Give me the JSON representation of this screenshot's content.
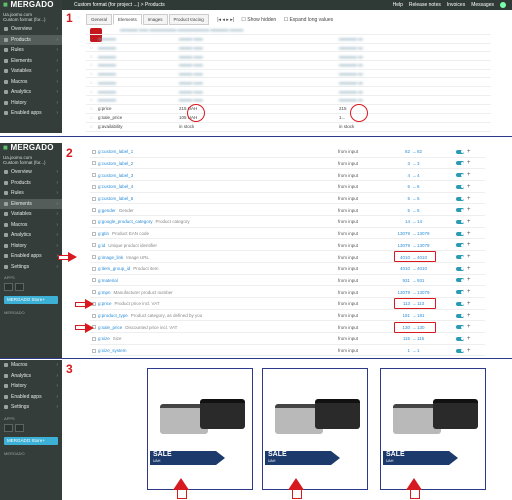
{
  "section_numbers": [
    "1",
    "2",
    "3"
  ],
  "topbar": {
    "breadcrumb": "Custom format (for project ...) > Products",
    "help": "Help",
    "release": "Release notes",
    "invoices": "Invoices",
    "messages": "Messages"
  },
  "sidebar1": {
    "logo": "MERGADO",
    "acct1": "Ua.joomo.com",
    "acct2": "Custom format (for...)",
    "items": [
      "Overview",
      "Products",
      "Rules",
      "Elements",
      "Variables",
      "Macros",
      "Analytics",
      "History",
      "Enabled apps"
    ]
  },
  "sidebar2": {
    "logo": "MERGADO",
    "acct1": "Ua.joomo.com",
    "acct2": "Custom format (for...)",
    "items": [
      "Overview",
      "Products",
      "Rules",
      "Elements",
      "Variables",
      "Macros",
      "Analytics",
      "History",
      "Enabled apps",
      "Settings"
    ],
    "apps_label": "APPS",
    "store": "MERGADO Store+",
    "footer": "MERGADO"
  },
  "sidebar3": {
    "items": [
      "Macros",
      "Analytics",
      "History",
      "Enabled apps",
      "Settings"
    ],
    "apps_label": "APPS",
    "store": "MERGADO Store+",
    "footer": "MERGADO"
  },
  "tabs": [
    "General",
    "Elements",
    "Images",
    "Product tracing"
  ],
  "checkboxes": [
    "Show hidden",
    "Expand long values"
  ],
  "fields": [
    {
      "name": "g:price",
      "value": "215 UAH"
    },
    {
      "name": "g:sale_price",
      "value": "105 UAH"
    },
    {
      "name": "g:availability",
      "value": "in stock"
    }
  ],
  "field_right": {
    "price": "215",
    "sale": "1..."
  },
  "rules": [
    {
      "name": "g:custom_label_1",
      "desc": "",
      "fi": "from input",
      "a": "82",
      "b": "82"
    },
    {
      "name": "g:custom_label_2",
      "desc": "",
      "fi": "from input",
      "a": "3",
      "b": "3"
    },
    {
      "name": "g:custom_label_3",
      "desc": "",
      "fi": "from input",
      "a": "4",
      "b": "4"
    },
    {
      "name": "g:custom_label_4",
      "desc": "",
      "fi": "from input",
      "a": "6",
      "b": "6"
    },
    {
      "name": "g:custom_label_5",
      "desc": "",
      "fi": "from input",
      "a": "5",
      "b": "5"
    },
    {
      "name": "g:gender",
      "desc": "Gender",
      "fi": "from input",
      "a": "5",
      "b": "5"
    },
    {
      "name": "g:google_product_category",
      "desc": "Product category",
      "fi": "from input",
      "a": "14",
      "b": "14"
    },
    {
      "name": "g:gtin",
      "desc": "Product EAN code",
      "fi": "from input",
      "a": "13079",
      "b": "13079"
    },
    {
      "name": "g:id",
      "desc": "Unique product identifier",
      "fi": "from input",
      "a": "13079",
      "b": "13079"
    },
    {
      "name": "g:image_link",
      "desc": "Image URL",
      "fi": "from input",
      "a": "4010",
      "b": "4010"
    },
    {
      "name": "g:item_group_id",
      "desc": "Product item",
      "fi": "from input",
      "a": "4010",
      "b": "4010"
    },
    {
      "name": "g:material",
      "desc": "",
      "fi": "from input",
      "a": "931",
      "b": "931"
    },
    {
      "name": "g:mpn",
      "desc": "Manufacturer product number",
      "fi": "from input",
      "a": "13079",
      "b": "13079"
    },
    {
      "name": "g:price",
      "desc": "Product price incl. VAT",
      "fi": "from input",
      "a": "113",
      "b": "113"
    },
    {
      "name": "g:product_type",
      "desc": "Product category, as defined by you",
      "fi": "from input",
      "a": "181",
      "b": "181"
    },
    {
      "name": "g:sale_price",
      "desc": "Discounted price incl. VAT",
      "fi": "from input",
      "a": "130",
      "b": "130"
    },
    {
      "name": "g:size",
      "desc": "Size",
      "fi": "from input",
      "a": "115",
      "b": "115"
    },
    {
      "name": "g:size_system",
      "desc": "",
      "fi": "from input",
      "a": "1",
      "b": "1"
    }
  ],
  "sale_badge": {
    "title": "SALE",
    "sub": "UAH"
  }
}
